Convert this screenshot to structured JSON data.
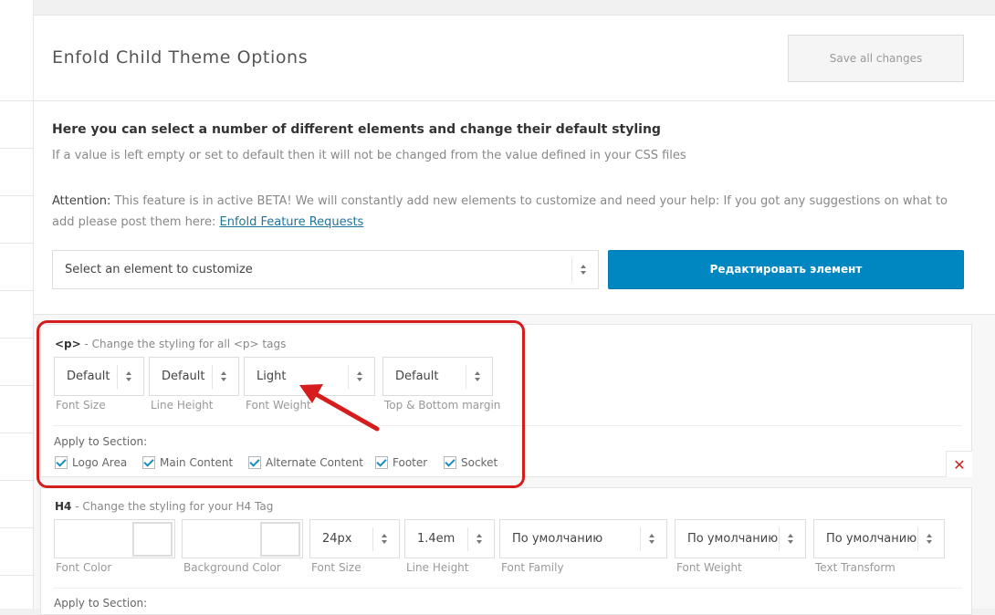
{
  "header": {
    "title": "Enfold Child Theme Options",
    "save_label": "Save all changes"
  },
  "intro": {
    "heading": "Here you can select a number of different elements and change their default styling",
    "text": "If a value is left empty or set to default then it will not be changed from the value defined in your CSS files",
    "attention_label": "Attention:",
    "attention_text": "This feature is in active BETA! We will constantly add new elements to customize and need your help: If you got any suggestions on what to add please post them here:",
    "link_text": "Enfold Feature Requests"
  },
  "element_select": {
    "value": "Select an element to customize",
    "edit_button": "Редактировать элемент"
  },
  "p_group": {
    "tag": "<p>",
    "description": "- Change the styling for all <p> tags",
    "fields": [
      {
        "value": "Default",
        "label": "Font Size"
      },
      {
        "value": "Default",
        "label": "Line Height"
      },
      {
        "value": "Light",
        "label": "Font Weight"
      },
      {
        "value": "Default",
        "label": "Top & Bottom margin"
      }
    ],
    "apply_label": "Apply to Section:",
    "sections": [
      "Logo Area",
      "Main Content",
      "Alternate Content",
      "Footer",
      "Socket"
    ]
  },
  "h4_group": {
    "tag": "H4",
    "description": "- Change the styling for your H4 Tag",
    "colors": [
      {
        "label": "Font Color"
      },
      {
        "label": "Background Color"
      }
    ],
    "fields": [
      {
        "value": "24px",
        "label": "Font Size"
      },
      {
        "value": "1.4em",
        "label": "Line Height"
      },
      {
        "value": "По умолчанию",
        "label": "Font Family"
      },
      {
        "value": "По умолчанию",
        "label": "Font Weight"
      },
      {
        "value": "По умолчанию",
        "label": "Text Transform"
      }
    ],
    "apply_label": "Apply to Section:"
  },
  "colors": {
    "accent": "#0087c1",
    "link": "#21759b",
    "annotation": "#d61d1d",
    "delete": "#cc2424"
  },
  "icons": {
    "delete": "close-x-icon",
    "annotation": "red-arrow-icon"
  }
}
